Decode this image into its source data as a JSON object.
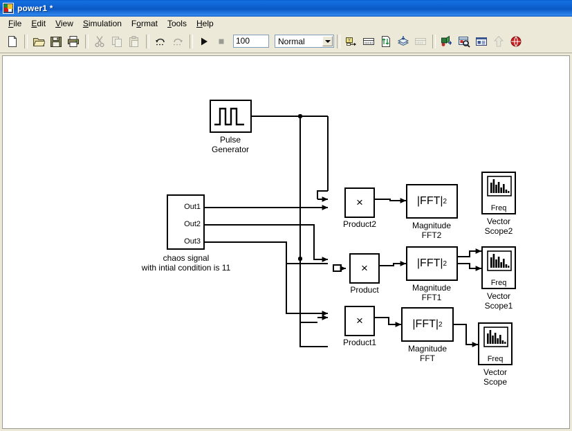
{
  "window": {
    "title": "power1 *",
    "icon": "simulink-model-icon"
  },
  "menu": {
    "items": [
      {
        "label": "File",
        "accel": "F"
      },
      {
        "label": "Edit",
        "accel": "E"
      },
      {
        "label": "View",
        "accel": "V"
      },
      {
        "label": "Simulation",
        "accel": "S"
      },
      {
        "label": "Format",
        "accel": "o"
      },
      {
        "label": "Tools",
        "accel": "T"
      },
      {
        "label": "Help",
        "accel": "H"
      }
    ]
  },
  "toolbar": {
    "buttons": [
      {
        "name": "new-model-icon",
        "enabled": true
      },
      {
        "name": "open-model-icon",
        "enabled": true
      },
      {
        "name": "save-model-icon",
        "enabled": true
      },
      {
        "name": "print-model-icon",
        "enabled": true
      },
      {
        "name": "cut-icon",
        "enabled": false
      },
      {
        "name": "copy-icon",
        "enabled": false
      },
      {
        "name": "paste-icon",
        "enabled": false
      },
      {
        "name": "undo-icon",
        "enabled": true
      },
      {
        "name": "redo-icon",
        "enabled": false
      },
      {
        "name": "start-simulation-icon",
        "enabled": true
      },
      {
        "name": "stop-simulation-icon",
        "enabled": false
      },
      {
        "name": "library-browser-icon",
        "enabled": true
      },
      {
        "name": "model-explorer-icon",
        "enabled": true
      },
      {
        "name": "update-diagram-icon",
        "enabled": true
      },
      {
        "name": "build-model-icon",
        "enabled": true
      },
      {
        "name": "toggle-model-browser-icon",
        "enabled": false
      },
      {
        "name": "debug-model-icon",
        "enabled": true
      },
      {
        "name": "find-icon",
        "enabled": true
      },
      {
        "name": "model-properties-icon",
        "enabled": true
      },
      {
        "name": "go-to-parent-icon",
        "enabled": false
      },
      {
        "name": "help-simulink-icon",
        "enabled": true
      }
    ],
    "stop_time_value": "100",
    "stop_time_placeholder": "Stop time",
    "sim_mode_value": "Normal",
    "sim_mode_options": [
      "Normal",
      "Accelerator",
      "Rapid Accelerator",
      "External"
    ]
  },
  "model": {
    "blocks": [
      {
        "id": "pulse_generator",
        "label": "Pulse\nGenerator",
        "label_line1": "Pulse",
        "label_line2": "Generator",
        "type": "pulse-generator"
      },
      {
        "id": "chaos_subsystem",
        "label_line1": "chaos signal",
        "label_line2": "with intial condition is 11",
        "type": "subsystem",
        "ports": [
          "Out1",
          "Out2",
          "Out3"
        ]
      },
      {
        "id": "product2",
        "label": "Product2",
        "symbol": "×",
        "type": "product"
      },
      {
        "id": "product",
        "label": "Product",
        "symbol": "×",
        "type": "product"
      },
      {
        "id": "product1",
        "label": "Product1",
        "symbol": "×",
        "type": "product"
      },
      {
        "id": "magnitude_fft2",
        "label_line1": "Magnitude",
        "label_line2": "FFT2",
        "symbol": "|FFT|",
        "exponent": "2",
        "type": "magnitude-fft"
      },
      {
        "id": "magnitude_fft1",
        "label_line1": "Magnitude",
        "label_line2": "FFT1",
        "symbol": "|FFT|",
        "exponent": "2",
        "type": "magnitude-fft"
      },
      {
        "id": "magnitude_fft",
        "label_line1": "Magnitude",
        "label_line2": "FFT",
        "symbol": "|FFT|",
        "exponent": "2",
        "type": "magnitude-fft"
      },
      {
        "id": "vector_scope2",
        "label_line1": "Vector",
        "label_line2": "Scope2",
        "inner_label": "Freq",
        "type": "vector-scope"
      },
      {
        "id": "vector_scope1",
        "label_line1": "Vector",
        "label_line2": "Scope1",
        "inner_label": "Freq",
        "type": "vector-scope"
      },
      {
        "id": "vector_scope",
        "label_line1": "Vector",
        "label_line2": "Scope",
        "inner_label": "Freq",
        "type": "vector-scope"
      }
    ]
  },
  "colors": {
    "titlebar": "#0a59c6",
    "chrome": "#ece9d8",
    "canvas": "#ffffff",
    "wire": "#000000",
    "block_border": "#000000"
  }
}
